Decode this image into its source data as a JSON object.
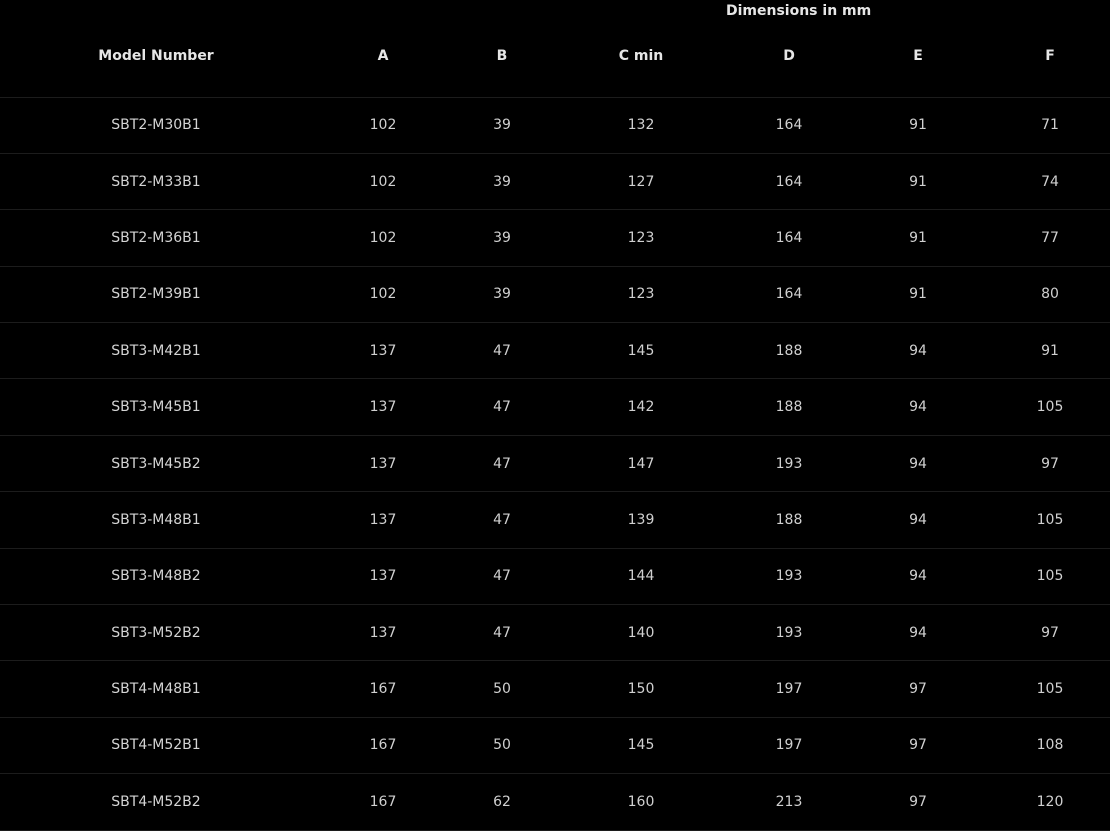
{
  "table": {
    "group_header": "Dimensions in mm",
    "columns": [
      "Model Number",
      "A",
      "B",
      "C min",
      "D",
      "E",
      "F"
    ],
    "rows": [
      [
        "SBT2-M30B1",
        "102",
        "39",
        "132",
        "164",
        "91",
        "71"
      ],
      [
        "SBT2-M33B1",
        "102",
        "39",
        "127",
        "164",
        "91",
        "74"
      ],
      [
        "SBT2-M36B1",
        "102",
        "39",
        "123",
        "164",
        "91",
        "77"
      ],
      [
        "SBT2-M39B1",
        "102",
        "39",
        "123",
        "164",
        "91",
        "80"
      ],
      [
        "SBT3-M42B1",
        "137",
        "47",
        "145",
        "188",
        "94",
        "91"
      ],
      [
        "SBT3-M45B1",
        "137",
        "47",
        "142",
        "188",
        "94",
        "105"
      ],
      [
        "SBT3-M45B2",
        "137",
        "47",
        "147",
        "193",
        "94",
        "97"
      ],
      [
        "SBT3-M48B1",
        "137",
        "47",
        "139",
        "188",
        "94",
        "105"
      ],
      [
        "SBT3-M48B2",
        "137",
        "47",
        "144",
        "193",
        "94",
        "105"
      ],
      [
        "SBT3-M52B2",
        "137",
        "47",
        "140",
        "193",
        "94",
        "97"
      ],
      [
        "SBT4-M48B1",
        "167",
        "50",
        "150",
        "197",
        "97",
        "105"
      ],
      [
        "SBT4-M52B1",
        "167",
        "50",
        "145",
        "197",
        "97",
        "108"
      ],
      [
        "SBT4-M52B2",
        "167",
        "62",
        "160",
        "213",
        "97",
        "120"
      ]
    ]
  },
  "colors": {
    "background": "#000000",
    "text": "#d8d8d8",
    "row_divider": "#1c1c1c"
  }
}
